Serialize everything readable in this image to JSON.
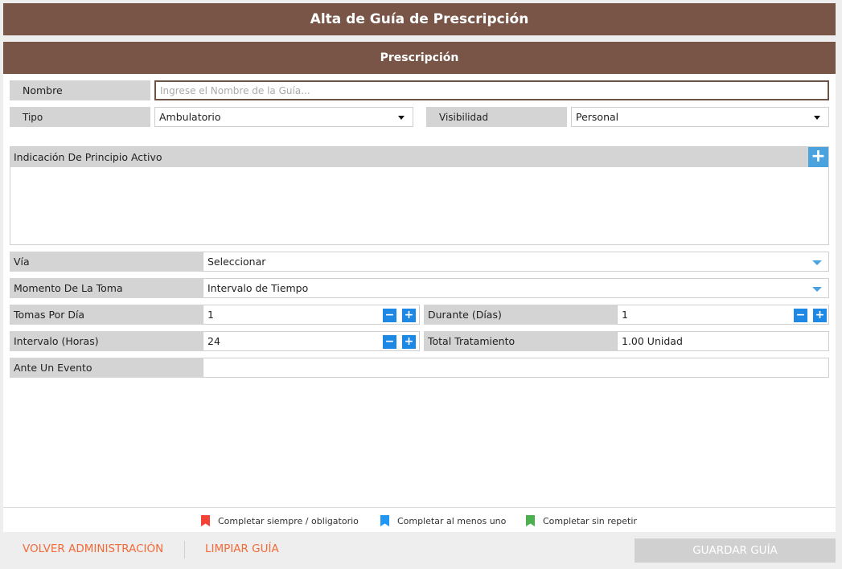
{
  "window": {
    "title": "Alta de Guía de Prescripción"
  },
  "section": {
    "title": "Prescripción"
  },
  "form": {
    "nombre": {
      "label": "Nombre",
      "placeholder": "Ingrese el Nombre de la Guía..."
    },
    "tipo": {
      "label": "Tipo",
      "value": "Ambulatorio"
    },
    "visibilidad": {
      "label": "Visibilidad",
      "value": "Personal"
    },
    "indicacion": {
      "label": "Indicación De Principio Activo",
      "add_icon": "plus-icon"
    },
    "via": {
      "label": "Vía",
      "value": "Seleccionar"
    },
    "momento": {
      "label": "Momento De La Toma",
      "value": "Intervalo de Tiempo"
    },
    "tomas": {
      "label": "Tomas Por Día",
      "value": "1"
    },
    "durante": {
      "label": "Durante (Días)",
      "value": "1"
    },
    "intervalo": {
      "label": "Intervalo (Horas)",
      "value": "24"
    },
    "total": {
      "label": "Total Tratamiento",
      "value": "1.00 Unidad"
    },
    "evento": {
      "label": "Ante Un Evento",
      "value": ""
    }
  },
  "stepper": {
    "minus": "−",
    "plus": "+"
  },
  "legend": [
    {
      "text": "Completar siempre / obligatorio",
      "color": "#f44336"
    },
    {
      "text": "Completar al menos uno",
      "color": "#2196f3"
    },
    {
      "text": "Completar sin repetir",
      "color": "#4caf50"
    }
  ],
  "footer": {
    "back_label": "VOLVER ADMINISTRACIÓN",
    "clear_label": "LIMPIAR GUÍA",
    "save_label": "GUARDAR GUÍA"
  },
  "colors": {
    "header": "#795548",
    "accent_link": "#f26b3a",
    "stepper": "#1e88e5"
  }
}
